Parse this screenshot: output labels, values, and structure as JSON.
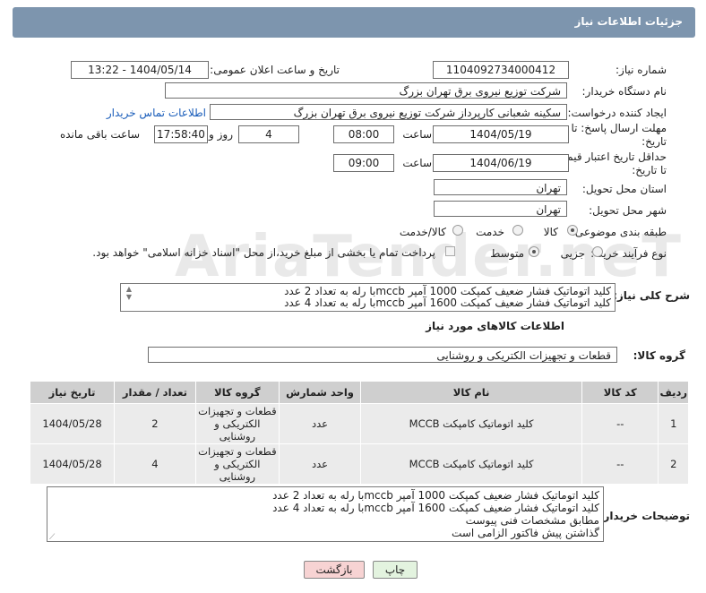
{
  "header": {
    "title": "جزئیات اطلاعات نیاز"
  },
  "form": {
    "need_number_label": "شماره نیاز:",
    "need_number": "1104092734000412",
    "announce_label": "تاریخ و ساعت اعلان عمومی:",
    "announce_value": "1404/05/14 - 13:22",
    "buyer_org_label": "نام دستگاه خریدار:",
    "buyer_org": "شرکت توزیع نیروی برق تهران بزرگ",
    "requester_label": "ایجاد کننده درخواست:",
    "requester": "سکینه شعبانی کارپرداز شرکت توزیع نیروی برق تهران بزرگ",
    "buyer_contact_link": "اطلاعات تماس خریدار",
    "reply_deadline_label": "مهلت ارسال پاسخ: تا تاریخ:",
    "reply_date": "1404/05/19",
    "time_label": "ساعت",
    "reply_time": "08:00",
    "days_value": "4",
    "days_label": "روز و",
    "remaining_time": "17:58:40",
    "remaining_label": "ساعت باقی مانده",
    "validity_label": "حداقل تاریخ اعتبار قیمت: تا تاریخ:",
    "validity_date": "1404/06/19",
    "validity_time": "09:00",
    "province_label": "استان محل تحویل:",
    "province": "تهران",
    "city_label": "شهر محل تحویل:",
    "city": "تهران",
    "category_label": "طبقه بندی موضوعی:",
    "category_options": [
      "کالا",
      "خدمت",
      "کالا/خدمت"
    ],
    "category_selected": "کالا",
    "process_label": "نوع فرآیند خرید :",
    "process_options": [
      "جزیی",
      "متوسط"
    ],
    "process_selected": "متوسط",
    "payment_note": "پرداخت تمام یا بخشی از مبلغ خرید،از محل \"اسناد خزانه اسلامی\" خواهد بود."
  },
  "description": {
    "label": "شرح کلی نیاز:",
    "lines": [
      "کلید اتوماتیک فشار ضعیف کمپکت 1000 آمپر mccbبا رله به تعداد 2 عدد",
      "کلید اتوماتیک فشار ضعیف کمپکت 1600 آمپر mccbبا رله به تعداد 4 عدد"
    ]
  },
  "goods_section": {
    "title": "اطلاعات کالاهای مورد نیاز",
    "group_label": "گروه کالا:",
    "group_value": "قطعات و تجهیزات الکتریکی و روشنایی"
  },
  "table": {
    "headers": [
      "ردیف",
      "کد کالا",
      "نام کالا",
      "واحد شمارش",
      "گروه کالا",
      "تعداد / مقدار",
      "تاریخ نیاز"
    ],
    "rows": [
      {
        "row": "1",
        "code": "--",
        "name": "کلید اتوماتیک کامپکت MCCB",
        "unit": "عدد",
        "group": "قطعات و تجهیزات الکتریکی و روشنایی",
        "qty": "2",
        "date": "1404/05/28"
      },
      {
        "row": "2",
        "code": "--",
        "name": "کلید اتوماتیک کامپکت MCCB",
        "unit": "عدد",
        "group": "قطعات و تجهیزات الکتریکی و روشنایی",
        "qty": "4",
        "date": "1404/05/28"
      }
    ]
  },
  "buyer_notes": {
    "label": "توضیحات خریدار:",
    "lines": [
      "کلید اتوماتیک فشار ضعیف کمپکت 1000 آمپر mccbبا رله به تعداد 2 عدد",
      "کلید اتوماتیک فشار ضعیف کمپکت 1600 آمپر mccbبا رله به تعداد 4 عدد",
      "مطابق مشخصات فنی پیوست",
      "گذاشتن پیش فاکتور الزامی است"
    ]
  },
  "buttons": {
    "print": "چاپ",
    "back": "بازگشت"
  },
  "colors": {
    "header_bg": "#7d95ae",
    "link": "#1a5dba",
    "back_button_bg": "#f7d3d3",
    "print_button_bg": "#e3f3df"
  }
}
